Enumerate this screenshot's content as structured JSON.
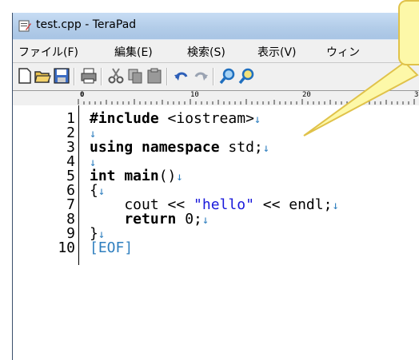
{
  "window": {
    "title": "test.cpp - TeraPad"
  },
  "menu": [
    "ファイル(F)",
    "編集(E)",
    "検索(S)",
    "表示(V)",
    "ウィン"
  ],
  "toolbar": {
    "buttons": [
      "new-file-icon",
      "open-folder-icon",
      "save-icon",
      "print-icon",
      "cut-icon",
      "copy-icon",
      "paste-icon",
      "undo-icon",
      "redo-icon",
      "find-icon",
      "find-next-icon"
    ]
  },
  "ruler": {
    "marks": [
      "0",
      "10",
      "20",
      "3"
    ]
  },
  "editor": {
    "line_numbers": [
      "1",
      "2",
      "3",
      "4",
      "5",
      "6",
      "7",
      "8",
      "9",
      "10"
    ],
    "lines": {
      "l1_kw": "#include",
      "l1_rest": " <iostream>",
      "l3_kw": "using namespace",
      "l3_rest": " std;",
      "l5_kw": "int main",
      "l5_rest": "()",
      "l6": "{",
      "l7_a": "    cout << ",
      "l7_str": "\"hello\"",
      "l7_b": " << endl;",
      "l8_kw": "    return",
      "l8_rest": " 0;",
      "l9": "}",
      "eof": "[EOF]"
    },
    "newline_mark": "↓"
  },
  "colors": {
    "accent": "#2f7fbf",
    "string": "#1a1adb",
    "callout": "#fdf8a8"
  }
}
